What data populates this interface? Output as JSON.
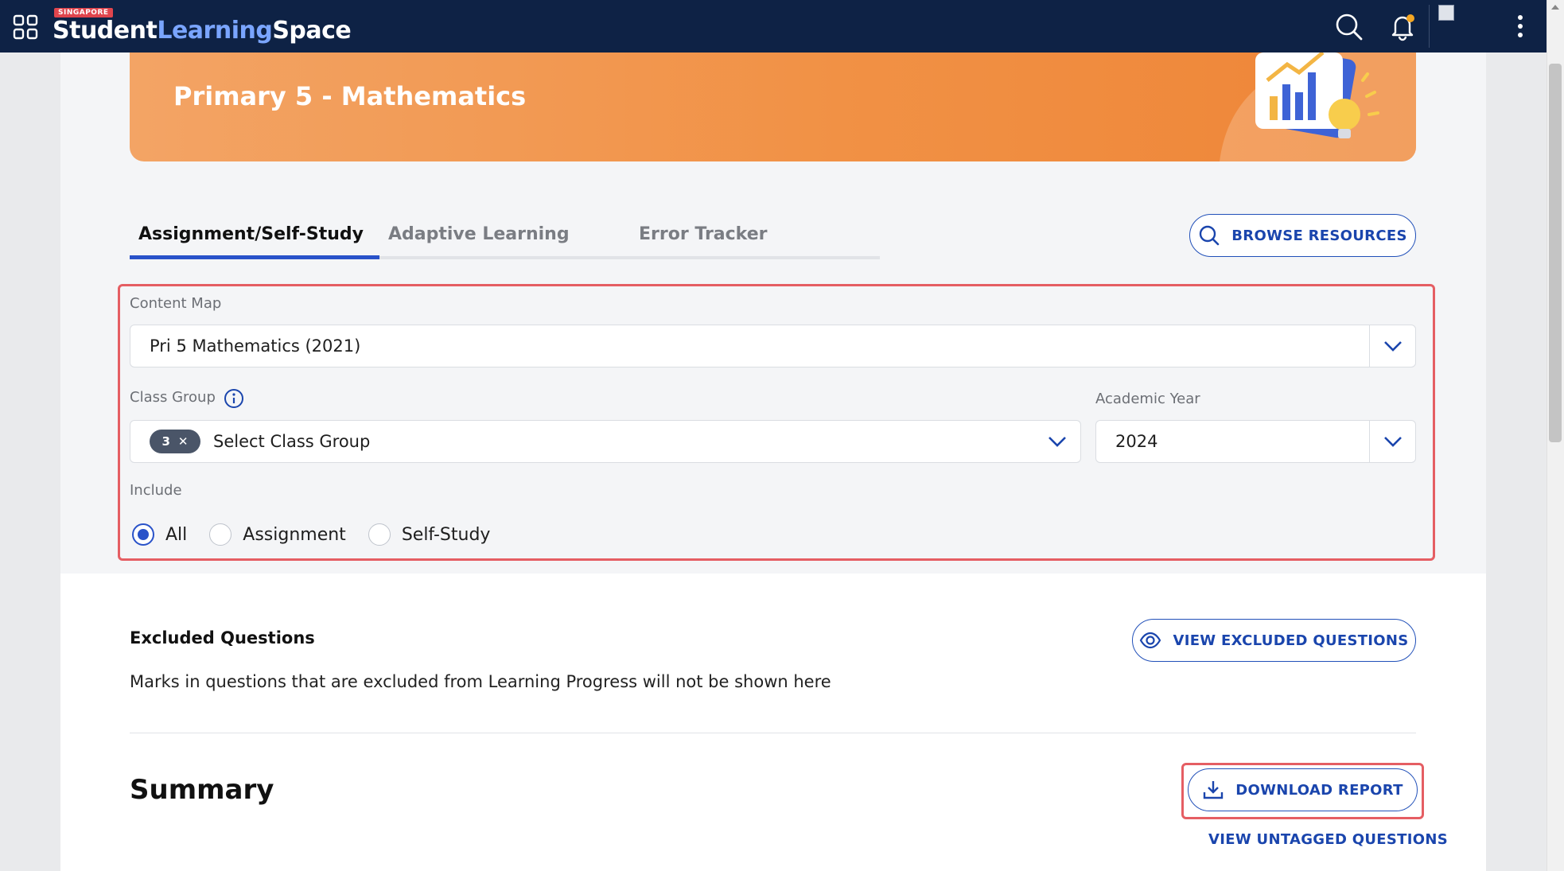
{
  "app": {
    "brand_tag": "SINGAPORE",
    "brand_1": "Student",
    "brand_2": "Learning",
    "brand_3": "Space"
  },
  "banner": {
    "title": "Primary 5 - Mathematics"
  },
  "tabs": [
    {
      "label": "Assignment/Self-Study",
      "active": true
    },
    {
      "label": "Adaptive Learning",
      "active": false
    },
    {
      "label": "Error Tracker",
      "active": false
    }
  ],
  "browse_label": "BROWSE RESOURCES",
  "filters": {
    "content_map_label": "Content Map",
    "content_map_value": "Pri 5 Mathematics (2021)",
    "class_group_label": "Class Group",
    "class_group_count": "3",
    "class_group_placeholder": "Select Class Group",
    "academic_year_label": "Academic Year",
    "academic_year_value": "2024",
    "include_label": "Include",
    "include_options": [
      "All",
      "Assignment",
      "Self-Study"
    ],
    "include_selected": "All"
  },
  "excluded": {
    "title": "Excluded Questions",
    "description": "Marks in questions that are excluded from Learning Progress will not be shown here",
    "button": "VIEW EXCLUDED QUESTIONS"
  },
  "summary": {
    "title": "Summary",
    "download_label": "DOWNLOAD REPORT",
    "untagged_label": "VIEW UNTAGGED QUESTIONS"
  },
  "colors": {
    "topbar": "#0e2245",
    "accent": "#2952c9",
    "banner": "#f19145",
    "highlight": "#e55e63"
  }
}
